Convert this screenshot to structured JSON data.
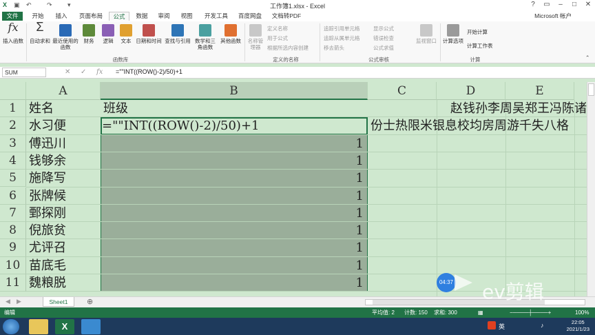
{
  "window": {
    "title": "工作簿1.xlsx - Excel",
    "help": "?",
    "min": "–",
    "max": "□",
    "close": "✕"
  },
  "ribbon_tabs": [
    "文件",
    "开始",
    "插入",
    "页面布局",
    "公式",
    "数据",
    "审阅",
    "视图",
    "开发工具",
    "百度网盘",
    "文档转PDF"
  ],
  "account": "Microsoft 帐户",
  "ribbon": {
    "insert_function": "插入函数",
    "autosum": "自动求和",
    "recent": "最近使用的函数",
    "financial": "财务",
    "logical": "逻辑",
    "text": "文本",
    "datetime": "日期和时间",
    "lookup": "查找与引用",
    "math": "数学和三角函数",
    "other": "其他函数",
    "group_library": "函数库",
    "name_manager": "名称管理器",
    "define_name": "定义名称",
    "use_in_formula": "用于公式",
    "create_from_sel": "根据所选内容创建",
    "group_names": "定义的名称",
    "trace_precedents": "追踪引用单元格",
    "trace_dependents": "追踪从属单元格",
    "remove_arrows": "移去箭头",
    "show_formulas": "显示公式",
    "error_checking": "错误检查",
    "evaluate": "公式求值",
    "watch": "监视窗口",
    "group_audit": "公式审核",
    "calc_options": "计算选项",
    "calc_now": "开始计算",
    "calc_sheet": "计算工作表",
    "group_calc": "计算"
  },
  "formula_bar": {
    "name_box": "SUM",
    "cancel": "✕",
    "enter": "✓",
    "fx": "fx",
    "formula": "=\"\"INT((ROW()-2)/50)+1"
  },
  "columns": [
    "A",
    "B",
    "C",
    "D",
    "E"
  ],
  "rows": [
    "1",
    "2",
    "3",
    "4",
    "5",
    "6",
    "7",
    "8",
    "9",
    "10",
    "11"
  ],
  "cells": {
    "A1": "姓名",
    "B1": "班级",
    "C1": "赵钱孙李周吴郑王冯陈诸",
    "A2": "水习便",
    "B2": "=\"\"INT((ROW()-2)/50)+1",
    "C2": "份士热限米银息校均房周游千失八格",
    "A3": "傅迅川",
    "A4": "钱够余",
    "A5": "施降写",
    "A6": "张牌候",
    "A7": "鄄探刚",
    "A8": "倪旅贫",
    "A9": "尤评召",
    "A10": "苗底毛",
    "A11": "魏粮脱",
    "B3": "1",
    "B4": "1",
    "B5": "1",
    "B6": "1",
    "B7": "1",
    "B8": "1",
    "B9": "1",
    "B10": "1",
    "B11": "1"
  },
  "sheet_tab": "Sheet1",
  "add_sheet": "⊕",
  "status": {
    "mode": "编辑",
    "average": "平均值: 2",
    "count": "计数: 150",
    "sum": "求和: 300",
    "zoom": "100%"
  },
  "taskbar": {
    "time": "22:05",
    "date": "2021/1/23",
    "lang": "英"
  },
  "overlay": {
    "timer": "04:37",
    "brand": "ev剪辑"
  }
}
